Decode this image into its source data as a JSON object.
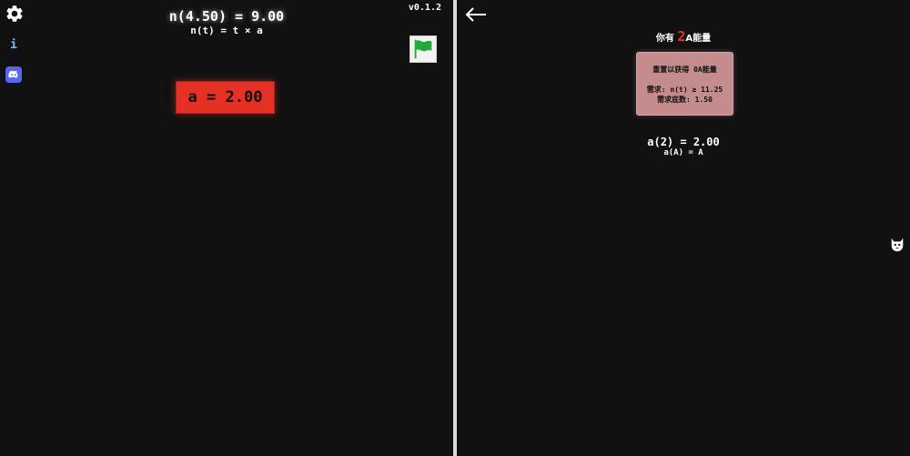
{
  "left": {
    "formula_main": "n(4.50) = 9.00",
    "formula_sub": "n(t) = t × a",
    "version": "v0.1.2",
    "a_button_label": "a = 2.00",
    "info_label": "i",
    "icons": [
      "gear-icon",
      "info-icon",
      "discord-icon",
      "flag-icon"
    ]
  },
  "right": {
    "energy_prefix": "你有 ",
    "energy_amount": "2",
    "energy_suffix": "A能量",
    "reset_card": {
      "title": "重置以获得 0A能量",
      "requirement": "需求: n(t) ≥ 11.25",
      "base": "需求底数: 1.50"
    },
    "a_value": "a(2) = 2.00",
    "a_formula": "a(A) = A",
    "icons": [
      "back-arrow-icon",
      "cat-icon"
    ]
  },
  "colors": {
    "background": "#111111",
    "accent_red": "#e53026",
    "card_bg": "#c48c8c",
    "info_blue": "#6cc3ff",
    "discord_blue": "#5865f2",
    "flag_green": "#1faa3a"
  }
}
